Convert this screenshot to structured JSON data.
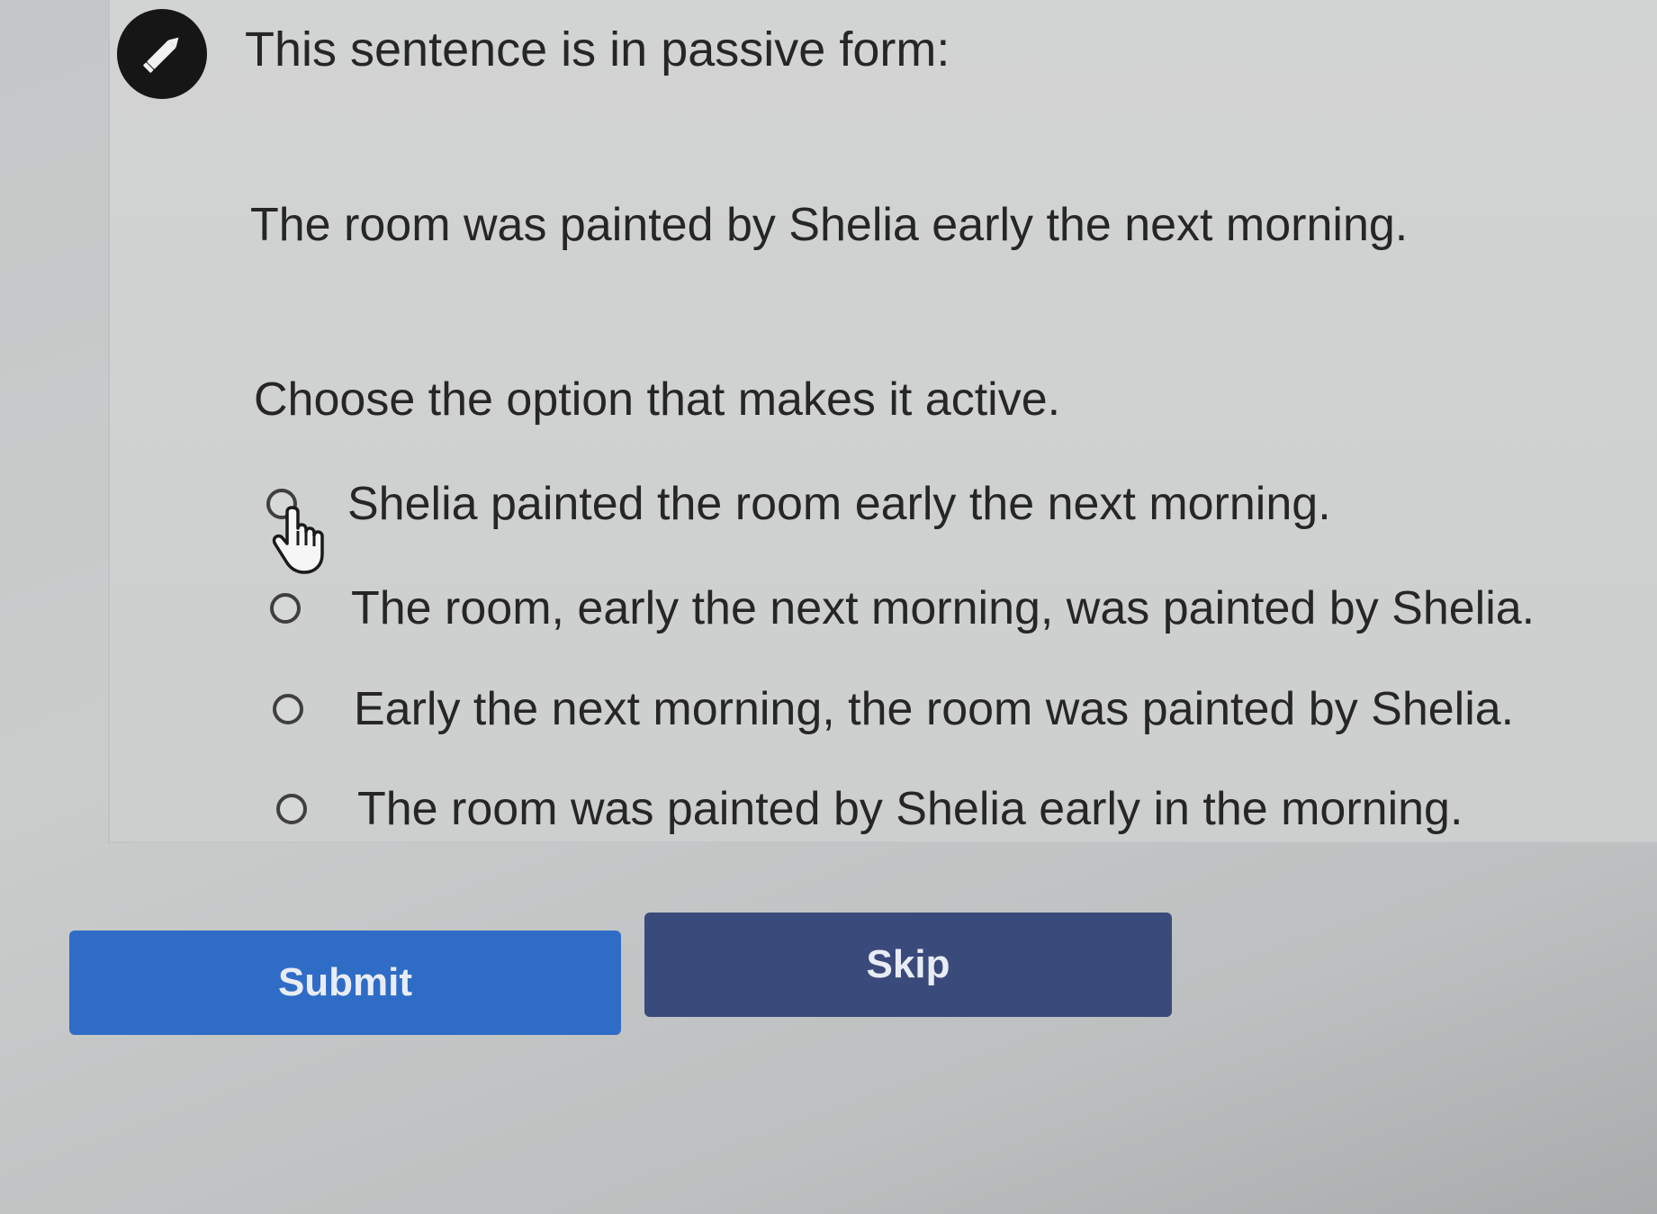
{
  "question": {
    "icon": "pencil-icon",
    "title": "This sentence is in passive form:",
    "sentence": "The room was painted by Shelia early the next morning.",
    "instruction": "Choose the option that makes it active."
  },
  "options": [
    {
      "label": "Shelia painted the room early the next morning.",
      "selected": false
    },
    {
      "label": "The room, early the next morning, was painted by Shelia.",
      "selected": false
    },
    {
      "label": "Early the next morning, the room was painted by Shelia.",
      "selected": false
    },
    {
      "label": "The room was painted by Shelia early in the morning.",
      "selected": false
    }
  ],
  "buttons": {
    "submit_label": "Submit",
    "skip_label": "Skip"
  },
  "colors": {
    "submit": "#2f6cc6",
    "skip": "#3a4a7a",
    "badge": "#161616"
  }
}
